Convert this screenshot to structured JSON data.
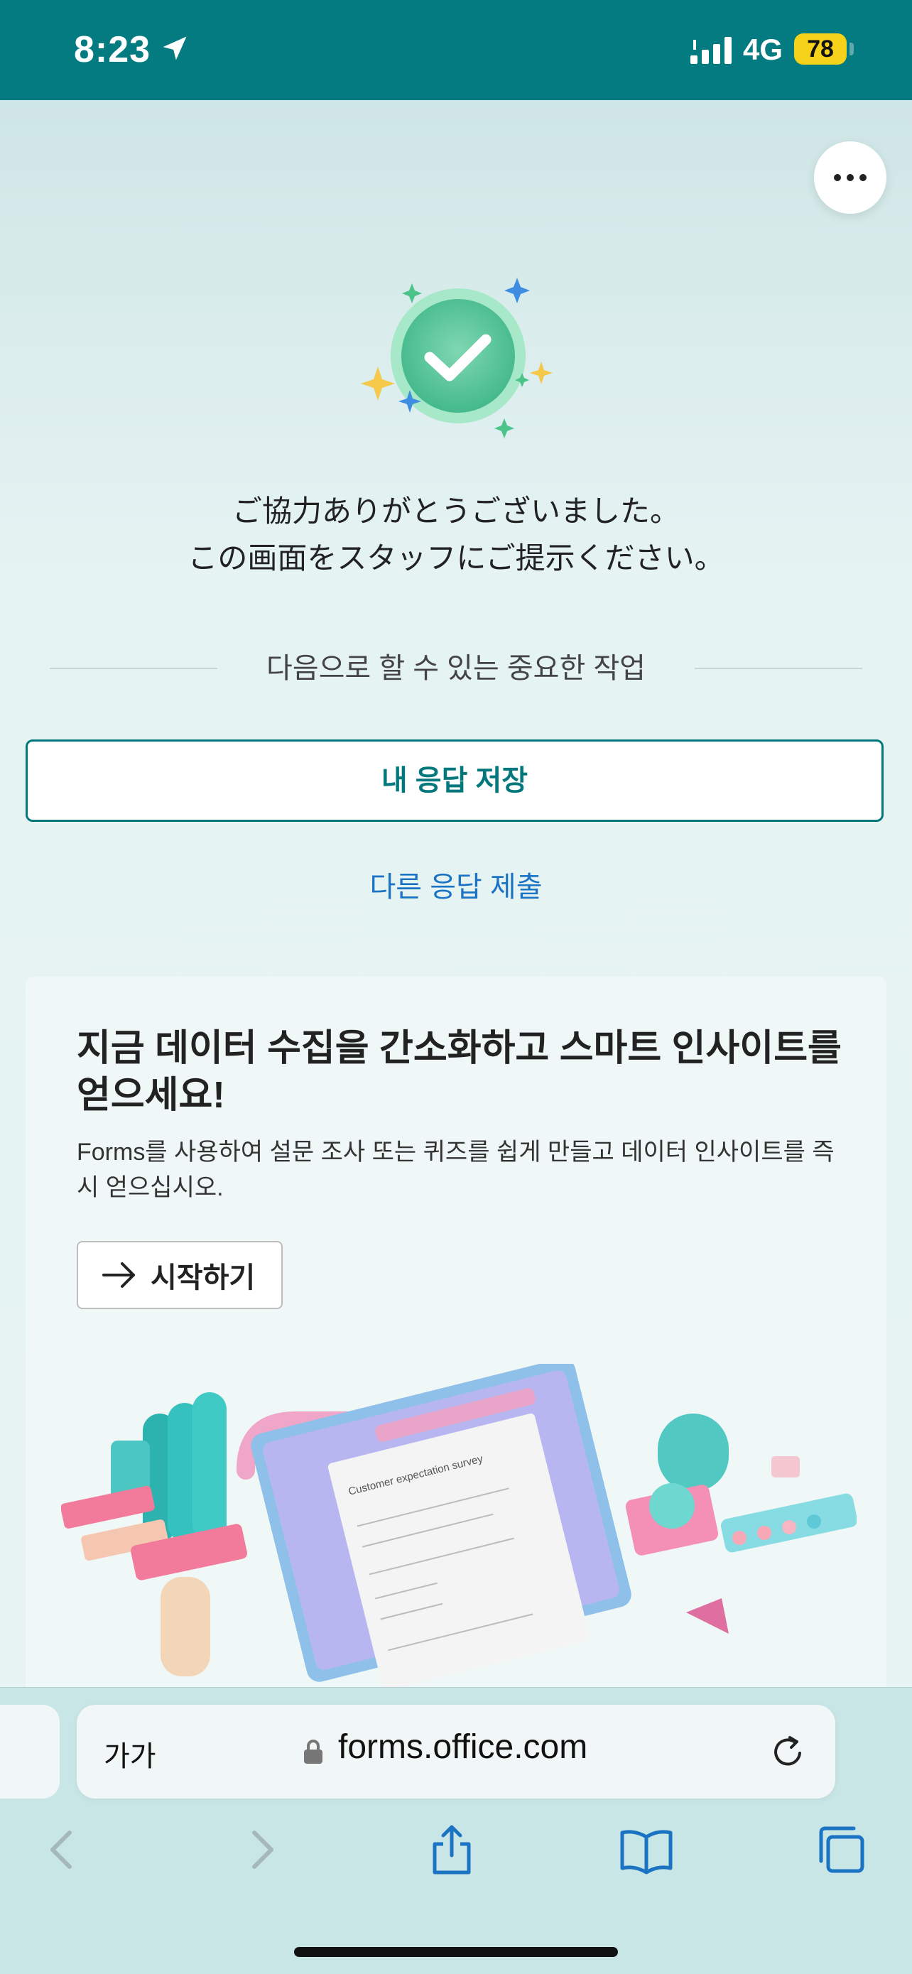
{
  "status_bar": {
    "time": "8:23",
    "network": "4G",
    "battery": "78"
  },
  "page": {
    "thanks_line1": "ご協力ありがとうございました。",
    "thanks_line2": "この画面をスタッフにご提示ください。",
    "next_steps": "다음으로 할 수 있는 중요한 작업",
    "save_response": "내 응답 저장",
    "submit_another": "다른 응답 제출"
  },
  "promo": {
    "title": "지금 데이터 수집을 간소화하고 스마트 인사이트를 얻으세요!",
    "description": "Forms를 사용하여 설문 조사 또는 퀴즈를 쉽게 만들고 데이터 인사이트를 즉시 얻으십시오.",
    "start_button": "시작하기",
    "illustration_survey_title": "Customer expectation survey"
  },
  "safari": {
    "text_size": "가가",
    "domain": "forms.office.com"
  },
  "colors": {
    "status_bar": "#047b80",
    "accent": "#03787c",
    "link": "#1b73c4",
    "battery": "#f7d21a"
  },
  "icons": [
    "location-arrow-icon",
    "signal-icon",
    "more-icon",
    "check-icon",
    "sparkle-icon",
    "arrow-right-icon",
    "lock-icon",
    "reload-icon",
    "back-icon",
    "forward-icon",
    "share-icon",
    "bookmarks-icon",
    "tabs-icon"
  ]
}
